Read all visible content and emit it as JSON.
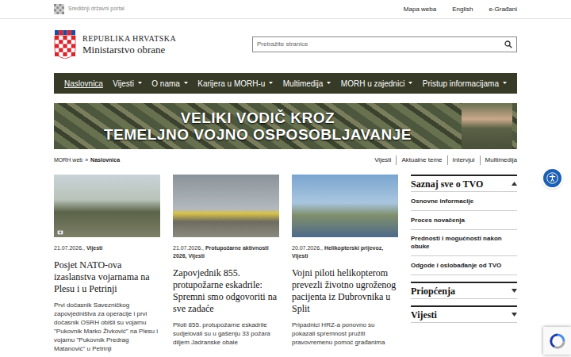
{
  "topbar": {
    "portal": "Središnji državni portal",
    "links": [
      "Mapa weba",
      "English",
      "e-Građani"
    ]
  },
  "header": {
    "line1": "REPUBLIKA HRVATSKA",
    "line2": "Ministarstvo obrane"
  },
  "search": {
    "placeholder": "Pretražite stranice"
  },
  "nav": [
    {
      "label": "Naslovnica",
      "selected": true,
      "dropdown": false
    },
    {
      "label": "Vijesti",
      "selected": false,
      "dropdown": true
    },
    {
      "label": "O nama",
      "selected": false,
      "dropdown": true
    },
    {
      "label": "Karijera u MORH-u",
      "selected": false,
      "dropdown": true
    },
    {
      "label": "Multimedija",
      "selected": false,
      "dropdown": true
    },
    {
      "label": "MORH u zajednici",
      "selected": false,
      "dropdown": true
    },
    {
      "label": "Pristup informacijama",
      "selected": false,
      "dropdown": true
    }
  ],
  "banner": {
    "line1": "VELIKI VODIČ KROZ",
    "line2": "TEMELJNO VOJNO OSPOSOBLJAVANJE"
  },
  "breadcrumb": {
    "items": [
      "MORH web",
      "Naslovnica"
    ],
    "separator": "»"
  },
  "section_links": [
    "Vijesti",
    "Aktualne teme",
    "Intervjui",
    "Multimedija"
  ],
  "cards": [
    {
      "date": "21.07.2026.,",
      "categories": "Vijesti",
      "title": "Posjet NATO-ova izaslanstva vojarnama na Plesu i u Petrinji",
      "excerpt": "Prvi dočasnik Savezničkog zapovjedništva za operacije i prvi dočasnik OSRH obišli su vojarnu \"Pukovnik Marko Živković\" na Plesu i vojarnu \"Pukovnik Predrag Matanović\" u Petrinji",
      "photo_badge": true
    },
    {
      "date": "21.07.2026.,",
      "categories": "Protupožarne aktivnosti 2026, Vijesti",
      "title": "Zapovjednik 855. protupožarne eskadrile: Spremni smo odgovoriti na sve zadaće",
      "excerpt": "Piloti 855. protupožarne eskadrile sudjelovali su u gašenju 33 požara diljem Jadranske obale",
      "photo_badge": false
    },
    {
      "date": "20.07.2026.,",
      "categories": "Helikopterski prijevoz, Vijesti",
      "title": "Vojni piloti helikopterom prevezli životno ugroženog pacijenta iz Dubrovnika u Split",
      "excerpt": "Pripadnici HRZ-a ponovno su pokazali spremnost pružiti pravovremenu pomoć građanima",
      "photo_badge": false
    }
  ],
  "sidebar": [
    {
      "title": "Saznaj sve o TVO",
      "expanded": true,
      "items": [
        "Osnovne informacije",
        "Proces novačenja",
        "Prednosti i mogućnosti nakon obuke",
        "Odgode i oslobađanje od TVO"
      ]
    },
    {
      "title": "Priopćenja",
      "expanded": false,
      "items": []
    },
    {
      "title": "Vijesti",
      "expanded": false,
      "items": []
    }
  ]
}
